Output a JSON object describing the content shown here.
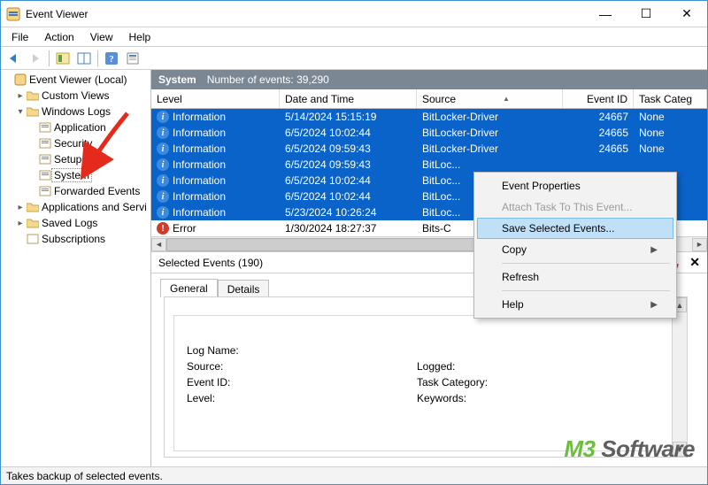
{
  "window": {
    "title": "Event Viewer"
  },
  "menubar": [
    "File",
    "Action",
    "View",
    "Help"
  ],
  "tree": {
    "root": "Event Viewer (Local)",
    "custom_views": "Custom Views",
    "windows_logs": "Windows Logs",
    "wl_children": [
      "Application",
      "Security",
      "Setup",
      "System",
      "Forwarded Events"
    ],
    "apps_svc": "Applications and Servi",
    "saved_logs": "Saved Logs",
    "subscriptions": "Subscriptions"
  },
  "pane": {
    "title": "System",
    "count_label": "Number of events: 39,290"
  },
  "columns": {
    "level": "Level",
    "dt": "Date and Time",
    "src": "Source",
    "eid": "Event ID",
    "tc": "Task Categ"
  },
  "rows": [
    {
      "icon": "info",
      "level": "Information",
      "dt": "5/14/2024 15:15:19",
      "src": "BitLocker-Driver",
      "eid": "24667",
      "tc": "None",
      "sel": true
    },
    {
      "icon": "info",
      "level": "Information",
      "dt": "6/5/2024 10:02:44",
      "src": "BitLocker-Driver",
      "eid": "24665",
      "tc": "None",
      "sel": true
    },
    {
      "icon": "info",
      "level": "Information",
      "dt": "6/5/2024 09:59:43",
      "src": "BitLocker-Driver",
      "eid": "24665",
      "tc": "None",
      "sel": true
    },
    {
      "icon": "info",
      "level": "Information",
      "dt": "6/5/2024 09:59:43",
      "src": "BitLoc...",
      "eid": "",
      "tc": "",
      "sel": true
    },
    {
      "icon": "info",
      "level": "Information",
      "dt": "6/5/2024 10:02:44",
      "src": "BitLoc...",
      "eid": "",
      "tc": "",
      "sel": true
    },
    {
      "icon": "info",
      "level": "Information",
      "dt": "6/5/2024 10:02:44",
      "src": "BitLoc...",
      "eid": "",
      "tc": "",
      "sel": true
    },
    {
      "icon": "info",
      "level": "Information",
      "dt": "5/23/2024 10:26:24",
      "src": "BitLoc...",
      "eid": "",
      "tc": "",
      "sel": true
    },
    {
      "icon": "err",
      "level": "Error",
      "dt": "1/30/2024 18:27:37",
      "src": "Bits-C",
      "eid": "",
      "tc": "",
      "sel": false
    }
  ],
  "context_menu": {
    "items": [
      {
        "label": "Event Properties",
        "kind": "item"
      },
      {
        "label": "Attach Task To This Event...",
        "kind": "disabled"
      },
      {
        "label": "Save Selected Events...",
        "kind": "hover"
      },
      {
        "label": "Copy",
        "kind": "sub"
      },
      {
        "kind": "sep"
      },
      {
        "label": "Refresh",
        "kind": "item"
      },
      {
        "kind": "sep"
      },
      {
        "label": "Help",
        "kind": "sub"
      }
    ]
  },
  "lower": {
    "title": "Selected Events (190)",
    "tab_general": "General",
    "tab_details": "Details",
    "fields": {
      "log_name": "Log Name:",
      "source": "Source:",
      "logged": "Logged:",
      "event_id": "Event ID:",
      "task_cat": "Task Category:",
      "level": "Level:",
      "keywords": "Keywords:"
    }
  },
  "statusbar": "Takes backup of selected events.",
  "watermark": {
    "m3": "M3",
    "sw": "Software"
  }
}
